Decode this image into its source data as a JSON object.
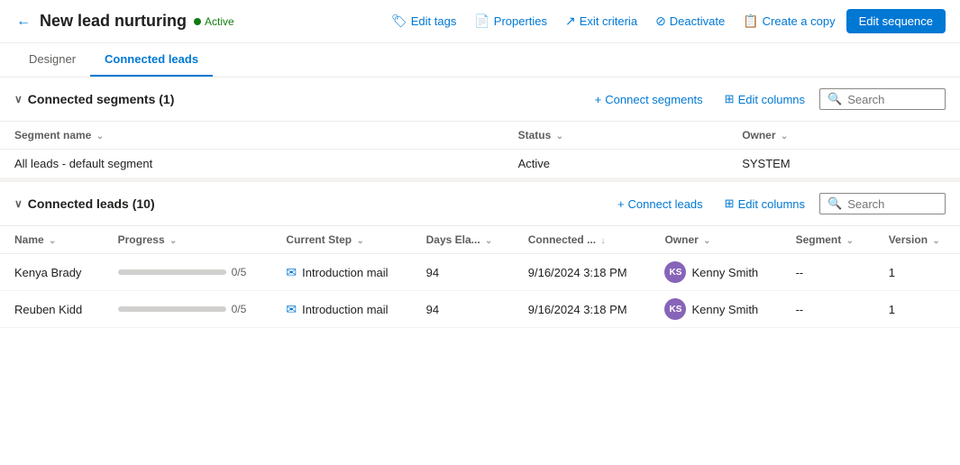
{
  "header": {
    "title": "New lead nurturing",
    "status": "Active",
    "back_label": "←",
    "actions": [
      {
        "id": "edit-tags",
        "label": "Edit tags",
        "icon": "🏷"
      },
      {
        "id": "properties",
        "label": "Properties",
        "icon": "📄"
      },
      {
        "id": "exit-criteria",
        "label": "Exit criteria",
        "icon": "↗"
      },
      {
        "id": "deactivate",
        "label": "Deactivate",
        "icon": "⊘"
      },
      {
        "id": "create-copy",
        "label": "Create a copy",
        "icon": "📋"
      }
    ],
    "edit_sequence_label": "Edit sequence"
  },
  "tabs": [
    {
      "id": "designer",
      "label": "Designer",
      "active": false
    },
    {
      "id": "connected-leads",
      "label": "Connected leads",
      "active": true
    }
  ],
  "connected_segments": {
    "title": "Connected segments",
    "count": 1,
    "actions": {
      "connect_label": "Connect segments",
      "edit_columns_label": "Edit columns",
      "search_placeholder": "Search"
    },
    "columns": [
      {
        "id": "segment-name",
        "label": "Segment name",
        "sortable": true
      },
      {
        "id": "status",
        "label": "Status",
        "sortable": true
      },
      {
        "id": "owner",
        "label": "Owner",
        "sortable": true
      }
    ],
    "rows": [
      {
        "segment_name": "All leads - default segment",
        "status": "Active",
        "owner": "SYSTEM"
      }
    ]
  },
  "connected_leads": {
    "title": "Connected leads",
    "count": 10,
    "actions": {
      "connect_label": "Connect leads",
      "edit_columns_label": "Edit columns",
      "search_placeholder": "Search"
    },
    "columns": [
      {
        "id": "name",
        "label": "Name",
        "sortable": true
      },
      {
        "id": "progress",
        "label": "Progress",
        "sortable": true
      },
      {
        "id": "current-step",
        "label": "Current Step",
        "sortable": true
      },
      {
        "id": "days-elapsed",
        "label": "Days Ela...",
        "sortable": true
      },
      {
        "id": "connected",
        "label": "Connected ...",
        "sortable": true,
        "sort_dir": "desc"
      },
      {
        "id": "owner",
        "label": "Owner",
        "sortable": true
      },
      {
        "id": "segment",
        "label": "Segment",
        "sortable": true
      },
      {
        "id": "version",
        "label": "Version",
        "sortable": true
      }
    ],
    "rows": [
      {
        "name": "Kenya Brady",
        "progress": 0,
        "progress_max": 5,
        "progress_label": "0/5",
        "current_step": "Introduction mail",
        "days_elapsed": "94",
        "connected_date": "9/16/2024 3:18 PM",
        "owner_name": "Kenny Smith",
        "owner_initials": "KS",
        "segment": "--",
        "version": "1"
      },
      {
        "name": "Reuben Kidd",
        "progress": 0,
        "progress_max": 5,
        "progress_label": "0/5",
        "current_step": "Introduction mail",
        "days_elapsed": "94",
        "connected_date": "9/16/2024 3:18 PM",
        "owner_name": "Kenny Smith",
        "owner_initials": "KS",
        "segment": "--",
        "version": "1"
      }
    ]
  }
}
